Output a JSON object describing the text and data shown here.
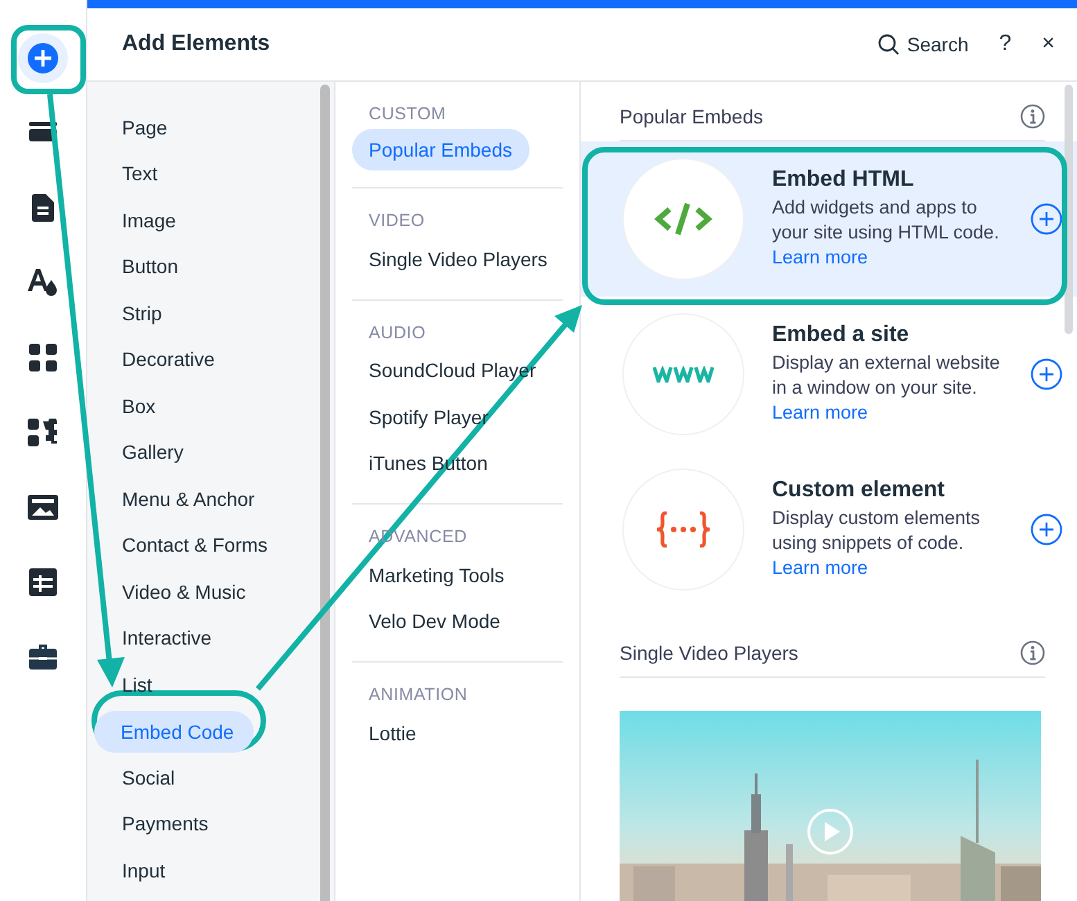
{
  "rail": [
    {
      "kind": "add",
      "selected": true
    },
    {
      "kind": "strip",
      "selected": false
    },
    {
      "kind": "page",
      "selected": false
    },
    {
      "kind": "theme",
      "selected": false
    },
    {
      "kind": "apps",
      "selected": false
    },
    {
      "kind": "plugins",
      "selected": false
    },
    {
      "kind": "media",
      "selected": false
    },
    {
      "kind": "table",
      "selected": false
    },
    {
      "kind": "business",
      "selected": false
    }
  ],
  "header": {
    "title": "Add Elements",
    "search": "Search",
    "help": "?",
    "close": "×"
  },
  "categories": [
    {
      "label": "Page",
      "selected": false
    },
    {
      "label": "Text",
      "selected": false
    },
    {
      "label": "Image",
      "selected": false
    },
    {
      "label": "Button",
      "selected": false
    },
    {
      "label": "Strip",
      "selected": false
    },
    {
      "label": "Decorative",
      "selected": false
    },
    {
      "label": "Box",
      "selected": false
    },
    {
      "label": "Gallery",
      "selected": false
    },
    {
      "label": "Menu & Anchor",
      "selected": false
    },
    {
      "label": "Contact & Forms",
      "selected": false
    },
    {
      "label": "Video & Music",
      "selected": false
    },
    {
      "label": "Interactive",
      "selected": false
    },
    {
      "label": "List",
      "selected": false
    },
    {
      "label": "Embed Code",
      "selected": true
    },
    {
      "label": "Social",
      "selected": false
    },
    {
      "label": "Payments",
      "selected": false
    },
    {
      "label": "Input",
      "selected": false
    }
  ],
  "subcategories": [
    {
      "heading": "CUSTOM",
      "items": [
        {
          "label": "Popular Embeds",
          "selected": true
        }
      ]
    },
    {
      "heading": "VIDEO",
      "items": [
        {
          "label": "Single Video Players",
          "selected": false
        }
      ]
    },
    {
      "heading": "AUDIO",
      "items": [
        {
          "label": "SoundCloud Player",
          "selected": false
        },
        {
          "label": "Spotify Player",
          "selected": false
        },
        {
          "label": "iTunes Button",
          "selected": false
        }
      ]
    },
    {
      "heading": "ADVANCED",
      "items": [
        {
          "label": "Marketing Tools",
          "selected": false
        },
        {
          "label": "Velo Dev Mode",
          "selected": false
        }
      ]
    },
    {
      "heading": "ANIMATION",
      "items": [
        {
          "label": "Lottie",
          "selected": false
        }
      ]
    }
  ],
  "sections": [
    {
      "title": "Popular Embeds",
      "cards": [
        {
          "kind": "html",
          "title": "Embed HTML",
          "description": "Add widgets and apps to your site using HTML code.",
          "link": "Learn more",
          "selected": true
        },
        {
          "kind": "site",
          "title": "Embed a site",
          "description": "Display an external website in a window on your site.",
          "link": "Learn more",
          "selected": false
        },
        {
          "kind": "custom",
          "title": "Custom element",
          "description": "Display custom elements using snippets of code.",
          "link": "Learn more",
          "selected": false
        }
      ]
    },
    {
      "title": "Single Video Players"
    }
  ]
}
